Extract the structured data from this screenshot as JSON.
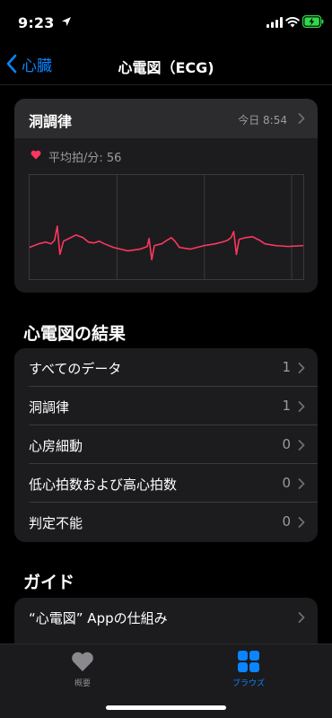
{
  "status_bar": {
    "time": "9:23"
  },
  "nav": {
    "back_label": "心臓",
    "title": "心電図（ECG)"
  },
  "ecg_card": {
    "title": "洞調律",
    "date": "今日 8:54",
    "avg_bpm": "平均拍/分: 56",
    "waveform_color": "#ff375f"
  },
  "results_section": {
    "title": "心電図の結果",
    "rows": [
      {
        "label": "すべてのデータ",
        "count": "1"
      },
      {
        "label": "洞調律",
        "count": "1"
      },
      {
        "label": "心房細動",
        "count": "0"
      },
      {
        "label": "低心拍数および高心拍数",
        "count": "0"
      },
      {
        "label": "判定不能",
        "count": "0"
      }
    ]
  },
  "guide_section": {
    "title": "ガイド",
    "rows": [
      {
        "label": "“心電図” Appの仕組み"
      }
    ]
  },
  "tabbar": {
    "tabs": [
      {
        "label": "概要",
        "icon": "heart-icon",
        "selected": false
      },
      {
        "label": "ブラウズ",
        "icon": "grid-icon",
        "selected": true
      }
    ]
  },
  "colors": {
    "accent": "#0a84ff",
    "heart": "#ff375f",
    "battery": "#32d74b"
  }
}
